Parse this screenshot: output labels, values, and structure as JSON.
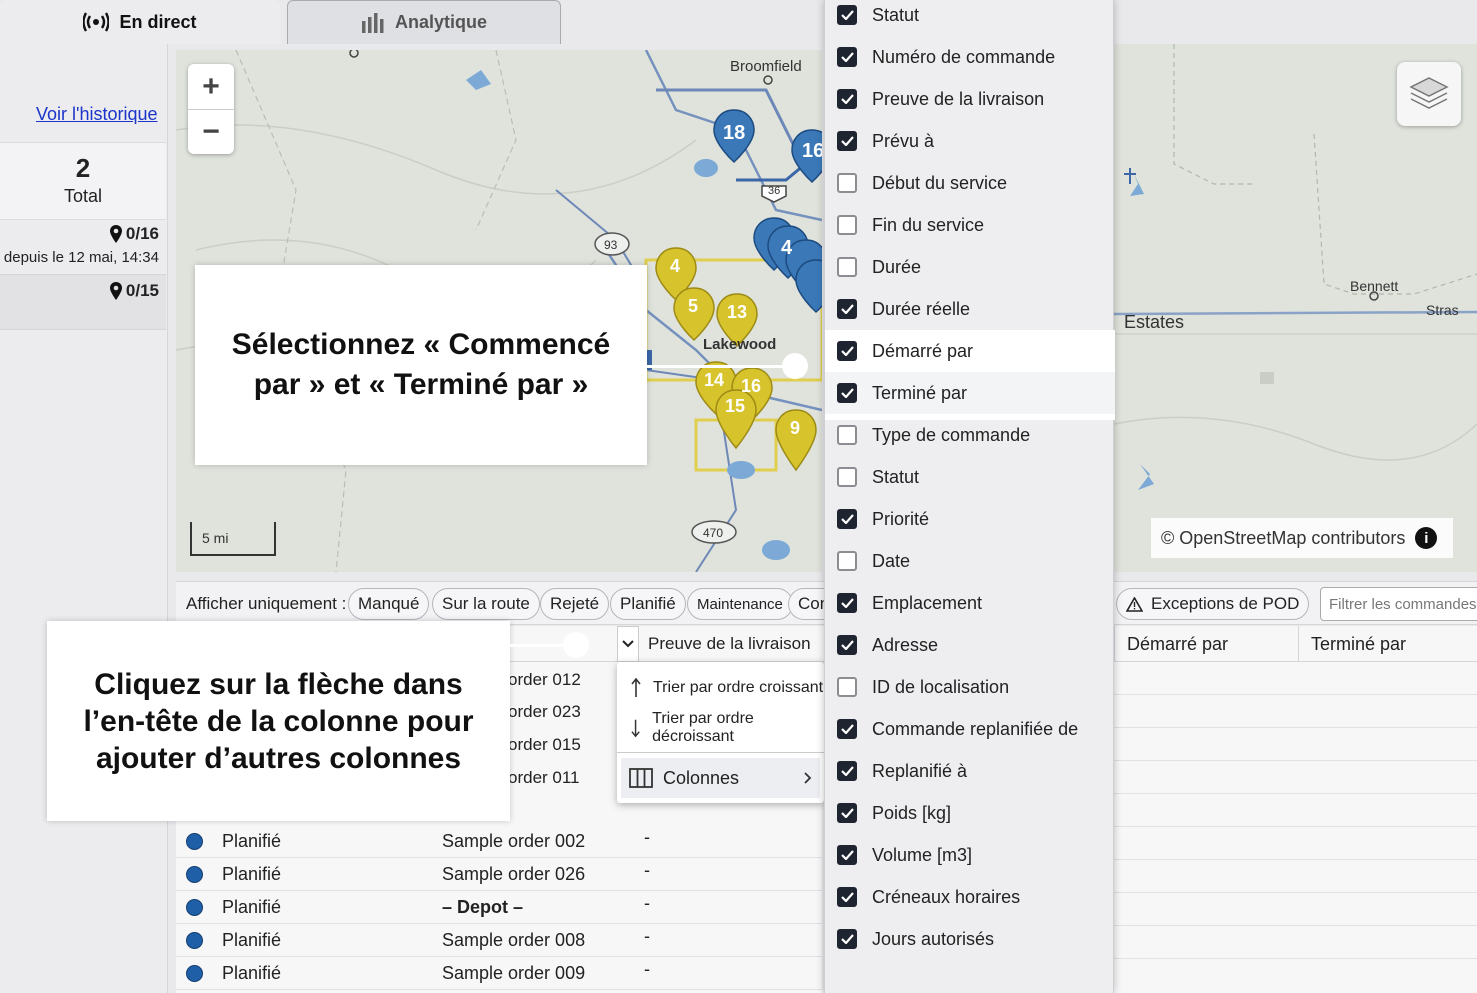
{
  "tabs": {
    "live": "En direct",
    "analytics": "Analytique"
  },
  "sidebar": {
    "history_link": "Voir l'historique",
    "total_value": "2",
    "total_label": "Total",
    "stat_1": "0/16",
    "since": "depuis le 12 mai, 14:34",
    "stat_2": "0/15"
  },
  "map": {
    "zoom_in": "+",
    "zoom_out": "−",
    "scale": "5 mi",
    "attribution": "© OpenStreetMap contributors",
    "labels": {
      "broomfield": "Broomfield",
      "lakewood": "Lakewood",
      "bennett": "Bennett",
      "estates": "Estates",
      "stras": "Stras",
      "hwy_93": "93",
      "hwy_470": "470",
      "hwy_36": "36"
    },
    "blue_markers": [
      "18",
      "16",
      "4"
    ],
    "yellow_markers": [
      "4",
      "5",
      "13",
      "14",
      "16",
      "15",
      "9"
    ],
    "colors": {
      "water": "#7ca9d6",
      "marker_blue": "#3a78b8",
      "marker_yellow": "#d7c32c",
      "road": "#5c7fb4"
    }
  },
  "filters": {
    "label": "Afficher uniquement :",
    "chips": [
      "Manqué",
      "Sur la route",
      "Rejeté",
      "Planifié",
      "Maintenance",
      "Con"
    ],
    "pod_chip": "Exceptions de POD",
    "search_placeholder": "Filtrer les commandes..."
  },
  "table": {
    "headers": {
      "pod": "Preuve de la livraison",
      "started_by": "Démarré par",
      "finished_by": "Terminé par"
    },
    "partial_orders": [
      "order 012",
      "order 023",
      "order 015",
      "order 011"
    ],
    "rows": [
      {
        "status": "Planifié",
        "order": "Sample order 002",
        "pod": "-"
      },
      {
        "status": "Planifié",
        "order": "Sample order 026",
        "pod": "-"
      },
      {
        "status": "Planifié",
        "order": "– Depot –",
        "pod": "-"
      },
      {
        "status": "Planifié",
        "order": "Sample order 008",
        "pod": "-"
      },
      {
        "status": "Planifié",
        "order": "Sample order 009",
        "pod": "-"
      }
    ]
  },
  "sort_menu": {
    "asc": "Trier par ordre croissant",
    "desc": "Trier par ordre décroissant",
    "columns": "Colonnes"
  },
  "column_picker": [
    {
      "label": "Statut",
      "checked": true
    },
    {
      "label": "Numéro de commande",
      "checked": true
    },
    {
      "label": "Preuve de la livraison",
      "checked": true
    },
    {
      "label": "Prévu à",
      "checked": true
    },
    {
      "label": "Début du service",
      "checked": false
    },
    {
      "label": "Fin du service",
      "checked": false
    },
    {
      "label": "Durée",
      "checked": false
    },
    {
      "label": "Durée réelle",
      "checked": true
    },
    {
      "label": "Démarré par",
      "checked": true
    },
    {
      "label": "Terminé par",
      "checked": true
    },
    {
      "label": "Type de commande",
      "checked": false
    },
    {
      "label": "Statut",
      "checked": false
    },
    {
      "label": "Priorité",
      "checked": true
    },
    {
      "label": "Date",
      "checked": false
    },
    {
      "label": "Emplacement",
      "checked": true
    },
    {
      "label": "Adresse",
      "checked": true
    },
    {
      "label": "ID de localisation",
      "checked": false
    },
    {
      "label": "Commande replanifiée de",
      "checked": true
    },
    {
      "label": "Replanifié à",
      "checked": true
    },
    {
      "label": "Poids [kg]",
      "checked": true
    },
    {
      "label": "Volume [m3]",
      "checked": true
    },
    {
      "label": "Créneaux horaires",
      "checked": true
    },
    {
      "label": "Jours autorisés",
      "checked": true
    }
  ],
  "callouts": {
    "select_columns": "Sélectionnez « Commencé par » et « Terminé par »",
    "click_arrow": "Cliquez sur la flèche dans l’en-tête de la colonne pour ajouter d’autres colonnes"
  }
}
